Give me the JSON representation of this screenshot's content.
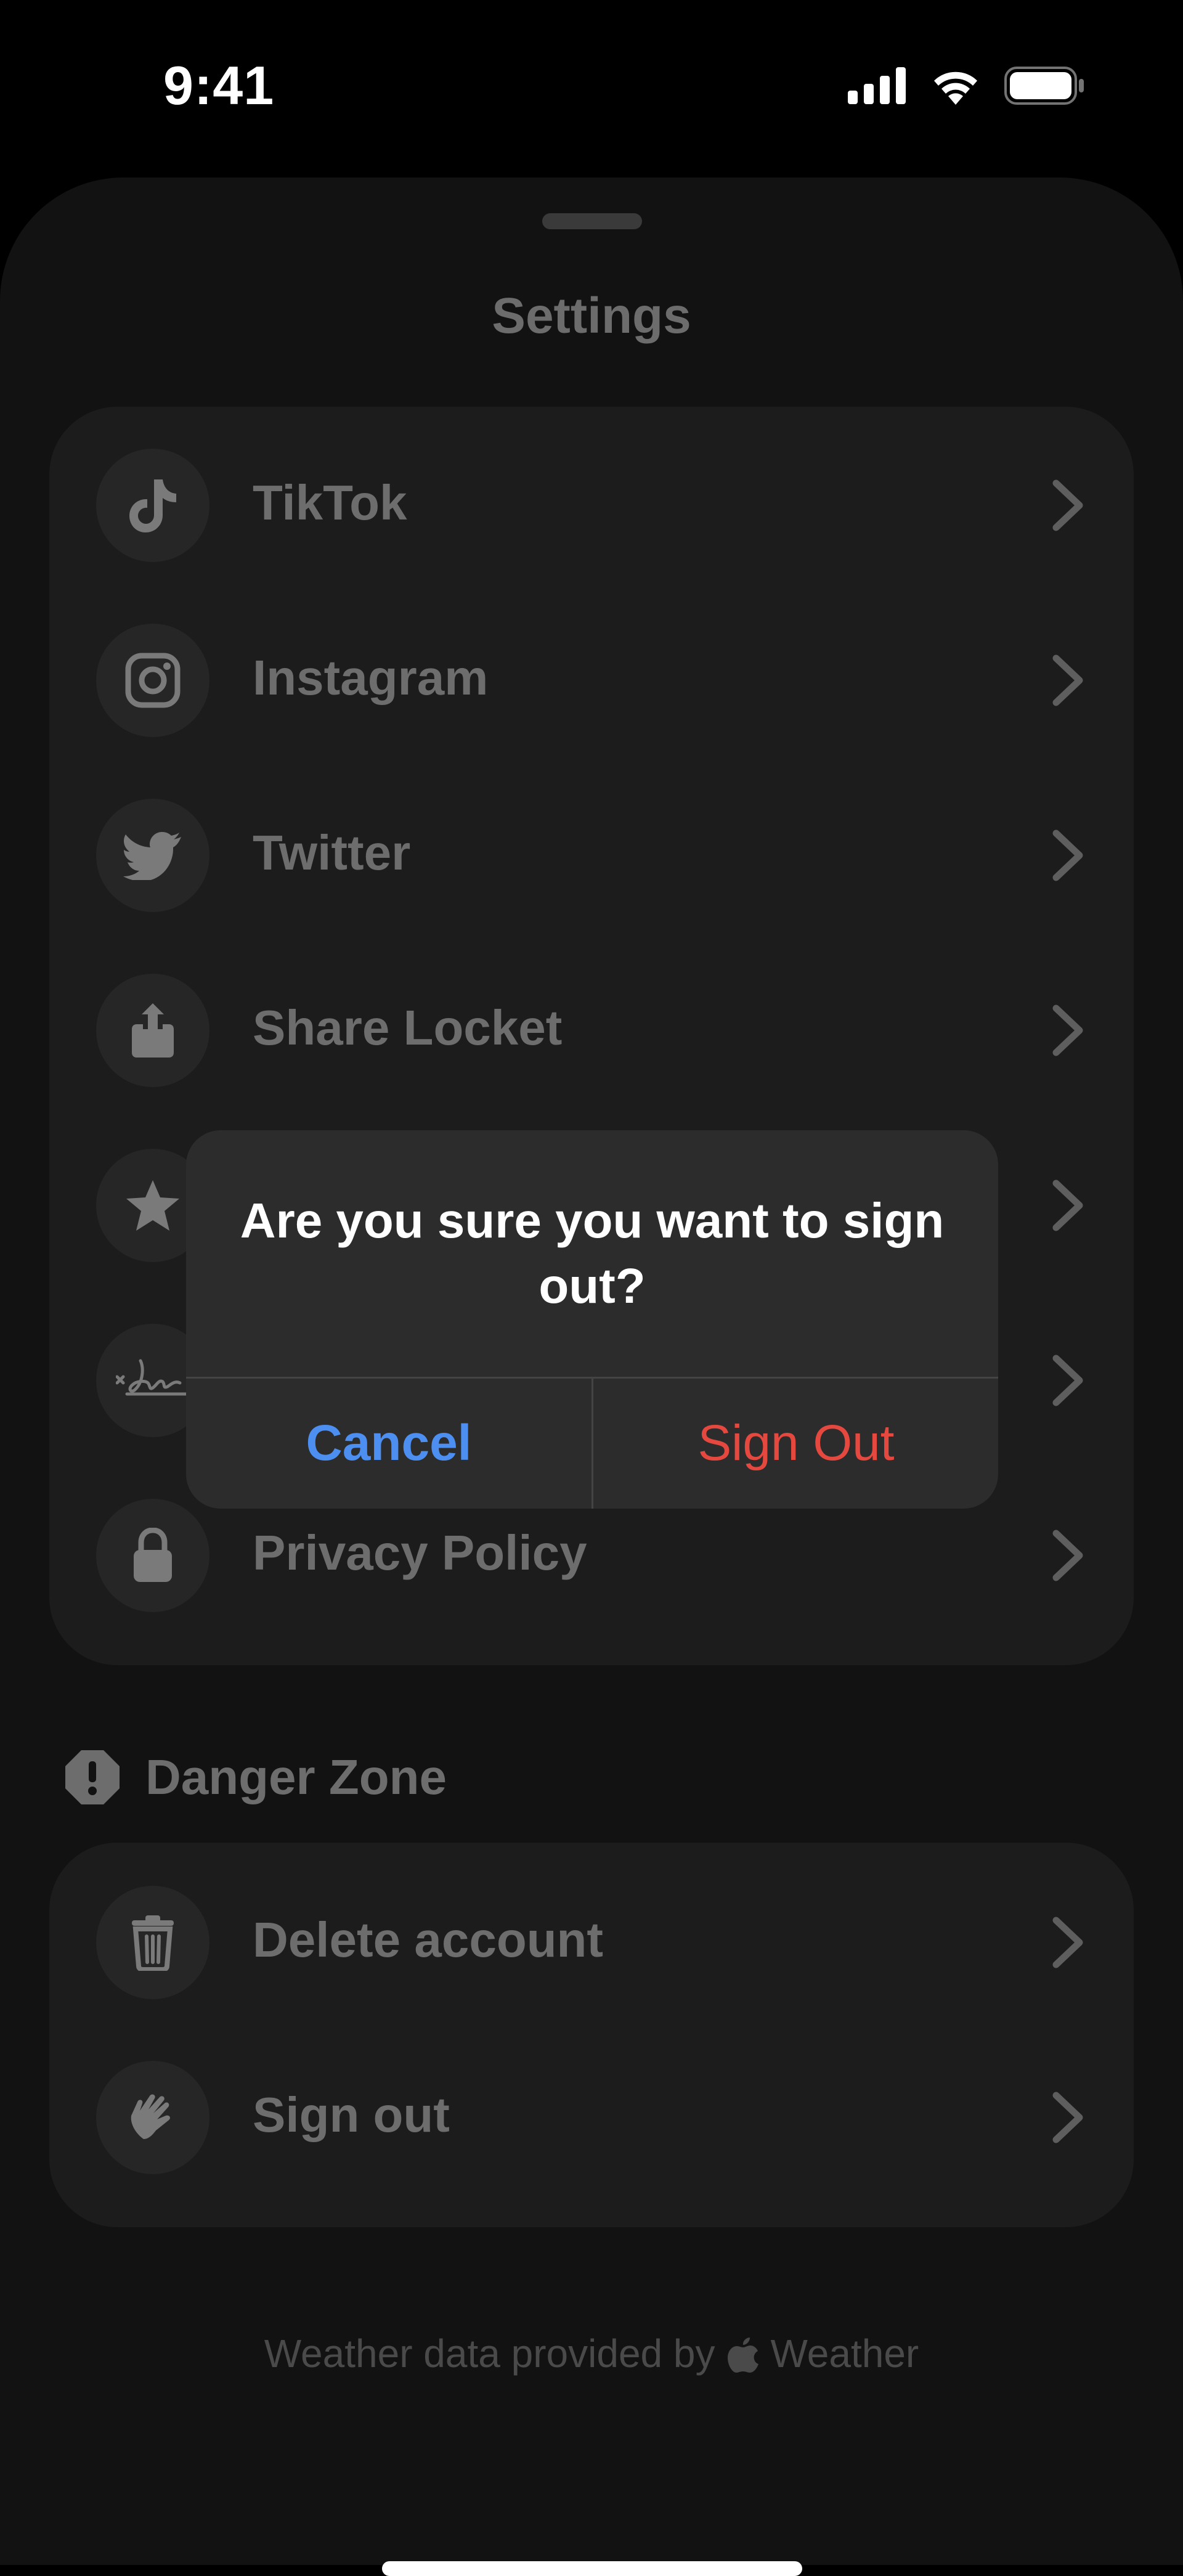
{
  "status_bar": {
    "time": "9:41"
  },
  "sheet": {
    "title": "Settings"
  },
  "settings_items": [
    {
      "label": "TikTok",
      "icon": "tiktok-icon"
    },
    {
      "label": "Instagram",
      "icon": "instagram-icon"
    },
    {
      "label": "Twitter",
      "icon": "twitter-icon"
    },
    {
      "label": "Share Locket",
      "icon": "share-icon"
    },
    {
      "label": "",
      "icon": "star-icon"
    },
    {
      "label": "",
      "icon": "signature-icon"
    },
    {
      "label": "Privacy Policy",
      "icon": "lock-icon"
    }
  ],
  "danger_zone": {
    "title": "Danger Zone",
    "items": [
      {
        "label": "Delete account",
        "icon": "trash-icon"
      },
      {
        "label": "Sign out",
        "icon": "wave-hand-icon"
      }
    ]
  },
  "footer": {
    "prefix": "Weather data provided by",
    "suffix": "Weather"
  },
  "alert": {
    "message": "Are you sure you want to sign out?",
    "cancel_label": "Cancel",
    "confirm_label": "Sign Out"
  },
  "colors": {
    "cancel": "#4c8ff0",
    "destructive": "#e5483f"
  }
}
